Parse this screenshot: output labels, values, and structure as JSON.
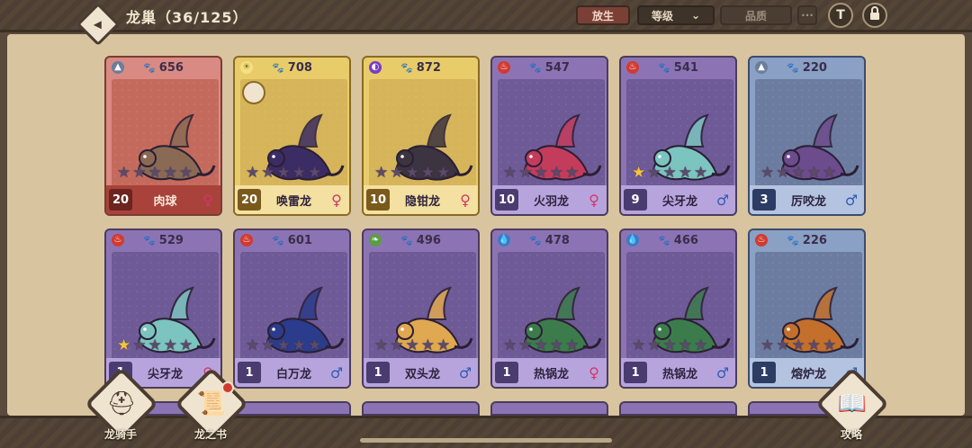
{
  "header": {
    "title": "龙巢（36/125）",
    "release_label": "放生",
    "sort_label": "等级",
    "sort_caret": "⌄",
    "quality_label": "品质",
    "more_label": "···",
    "filter_icon": "T",
    "lock_icon": "🔒"
  },
  "dragons": [
    {
      "power": "656",
      "element": "earth",
      "name": "肉球",
      "level": "20",
      "sex": "♀",
      "sex_class": "f",
      "stars": 0,
      "theme": "red",
      "body_color": "#8a6a54"
    },
    {
      "power": "708",
      "element": "storm",
      "name": "唤雷龙",
      "level": "20",
      "sex": "♀",
      "sex_class": "f",
      "stars": 0,
      "theme": "gold",
      "body_color": "#3c2c64"
    },
    {
      "power": "872",
      "element": "dark",
      "name": "隐钳龙",
      "level": "10",
      "sex": "♀",
      "sex_class": "f",
      "stars": 0,
      "theme": "gold",
      "body_color": "#3c3440"
    },
    {
      "power": "547",
      "element": "fire",
      "name": "火羽龙",
      "level": "10",
      "sex": "♀",
      "sex_class": "f",
      "stars": 0,
      "theme": "purple",
      "body_color": "#c43c5c"
    },
    {
      "power": "541",
      "element": "fire",
      "name": "尖牙龙",
      "level": "9",
      "sex": "♂",
      "sex_class": "m",
      "stars": 1,
      "theme": "purple",
      "body_color": "#7cc4c0"
    },
    {
      "power": "220",
      "element": "earth",
      "name": "厉咬龙",
      "level": "3",
      "sex": "♂",
      "sex_class": "m",
      "stars": 0,
      "theme": "blue",
      "body_color": "#6c4c8c"
    },
    {
      "power": "529",
      "element": "fire",
      "name": "尖牙龙",
      "level": "1",
      "sex": "♀",
      "sex_class": "f",
      "stars": 1,
      "theme": "purple",
      "body_color": "#7cc4c0"
    },
    {
      "power": "601",
      "element": "fire",
      "name": "白万龙",
      "level": "1",
      "sex": "♂",
      "sex_class": "m",
      "stars": 0,
      "theme": "purple",
      "body_color": "#2c3c8c"
    },
    {
      "power": "496",
      "element": "nature",
      "name": "双头龙",
      "level": "1",
      "sex": "♂",
      "sex_class": "m",
      "stars": 0,
      "theme": "purple",
      "body_color": "#e0a850"
    },
    {
      "power": "478",
      "element": "water",
      "name": "热锅龙",
      "level": "1",
      "sex": "♀",
      "sex_class": "f",
      "stars": 0,
      "theme": "purple",
      "body_color": "#3c7c4c"
    },
    {
      "power": "466",
      "element": "water",
      "name": "热锅龙",
      "level": "1",
      "sex": "♂",
      "sex_class": "m",
      "stars": 0,
      "theme": "purple",
      "body_color": "#3c7c4c"
    },
    {
      "power": "226",
      "element": "fire",
      "name": "熔炉龙",
      "level": "1",
      "sex": "♂",
      "sex_class": "m",
      "stars": 0,
      "theme": "blue",
      "body_color": "#c4702c"
    }
  ],
  "nav": {
    "rider_label": "龙骑手",
    "book_label": "龙之书",
    "guide_label": "攻略"
  }
}
